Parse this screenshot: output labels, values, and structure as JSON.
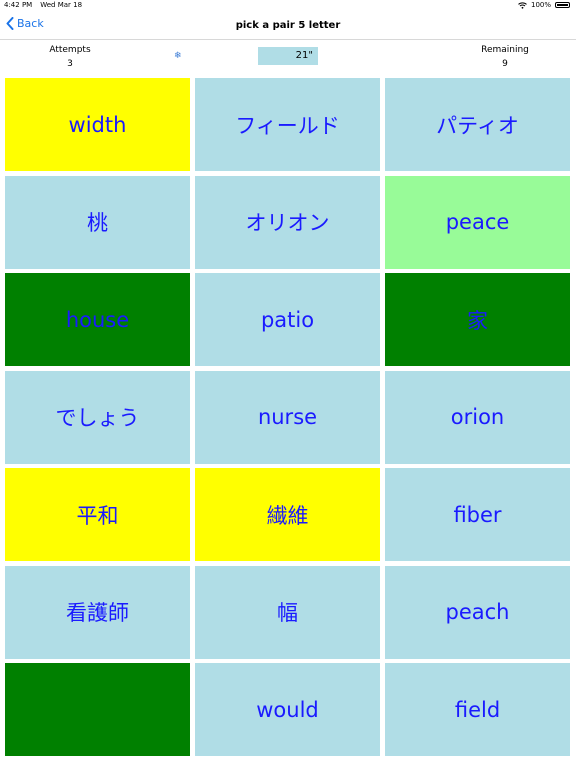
{
  "status_bar": {
    "time": "4:42 PM",
    "date": "Wed Mar 18",
    "battery_percent": "100%",
    "wifi_icon": "wifi-icon",
    "battery_icon": "battery-icon"
  },
  "nav": {
    "back_label": "Back",
    "title": "pick a pair 5 letter"
  },
  "stats": {
    "attempts_label": "Attempts",
    "attempts_value": "3",
    "gear_symbol": "❄",
    "timer": "21\"",
    "remaining_label": "Remaining",
    "remaining_value": "9"
  },
  "tile_colors": {
    "light": "#b0dde6",
    "yellow": "#ffff00",
    "lgreen": "#98fb98",
    "dgreen": "#008000",
    "text": "#1a1aff"
  },
  "tiles": [
    {
      "text": "width",
      "color": "yellow"
    },
    {
      "text": "フィールド",
      "color": "light"
    },
    {
      "text": "パティオ",
      "color": "light"
    },
    {
      "text": "桃",
      "color": "light"
    },
    {
      "text": "オリオン",
      "color": "light"
    },
    {
      "text": "peace",
      "color": "lgreen"
    },
    {
      "text": "house",
      "color": "dgreen"
    },
    {
      "text": "patio",
      "color": "light"
    },
    {
      "text": "家",
      "color": "dgreen"
    },
    {
      "text": "でしょう",
      "color": "light"
    },
    {
      "text": "nurse",
      "color": "light"
    },
    {
      "text": "orion",
      "color": "light"
    },
    {
      "text": "平和",
      "color": "yellow"
    },
    {
      "text": "繊維",
      "color": "yellow"
    },
    {
      "text": "fiber",
      "color": "light"
    },
    {
      "text": "看護師",
      "color": "light"
    },
    {
      "text": "幅",
      "color": "light"
    },
    {
      "text": "peach",
      "color": "light"
    },
    {
      "text": "",
      "color": "dgreen"
    },
    {
      "text": "would",
      "color": "light"
    },
    {
      "text": "field",
      "color": "light"
    }
  ]
}
